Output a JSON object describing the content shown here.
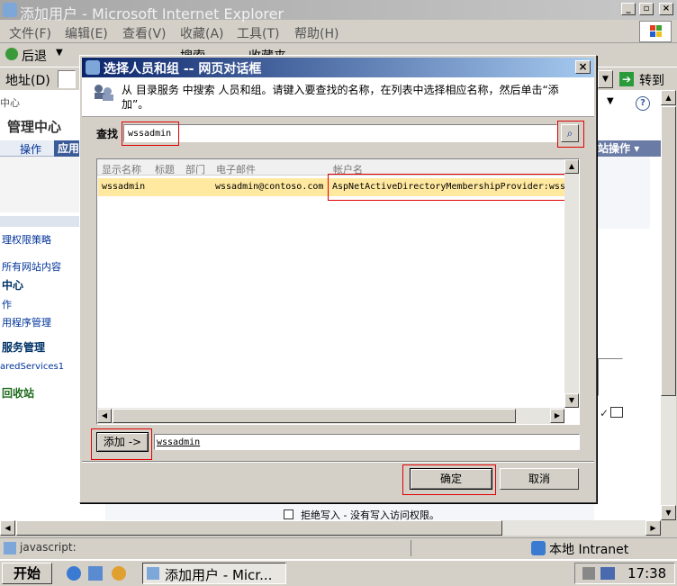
{
  "window": {
    "title": "添加用户 - Microsoft Internet Explorer"
  },
  "menu": [
    "文件(F)",
    "编辑(E)",
    "查看(V)",
    "收藏(A)",
    "工具(T)",
    "帮助(H)"
  ],
  "toolbar": {
    "back": "后退",
    "search": "搜索",
    "favorites": "收藏夹"
  },
  "addressbar": {
    "label": "地址(D)",
    "go": "转到"
  },
  "page": {
    "center_label": "中心",
    "admin_center": "管理中心",
    "tabs": [
      "操作",
      "应用"
    ],
    "site_actions": "站操作",
    "left_links": [
      "理权限策略",
      "所有网站内容"
    ],
    "section_center": "中心",
    "links2": [
      "作",
      "用程序管理"
    ],
    "section_services": "服务管理",
    "link_shared": "aredServices1",
    "recycle": "回收站",
    "bottom_text": "拒绝写入 - 没有写入访问权限。"
  },
  "dialog": {
    "title": "选择人员和组 -- 网页对话框",
    "info": "从 目录服务 中搜索 人员和组。请键入要查找的名称，在列表中选择相应名称，然后单击“添加”。",
    "find_label": "查找",
    "find_value": "wssadmin",
    "columns": [
      "显示名称",
      "标题",
      "部门",
      "电子邮件",
      "帐户名"
    ],
    "rows": [
      {
        "display": "wssadmin",
        "title": "",
        "dept": "",
        "email": "wssadmin@contoso.com",
        "account": "AspNetActiveDirectoryMembershipProvider:wss"
      }
    ],
    "add_button": "添加 ->",
    "add_value": "wssadmin",
    "ok": "确定",
    "cancel": "取消"
  },
  "status": {
    "text": "javascript:",
    "zone": "本地 Intranet"
  },
  "taskbar": {
    "start": "开始",
    "task": "添加用户 - Micr...",
    "clock": "17:38"
  }
}
